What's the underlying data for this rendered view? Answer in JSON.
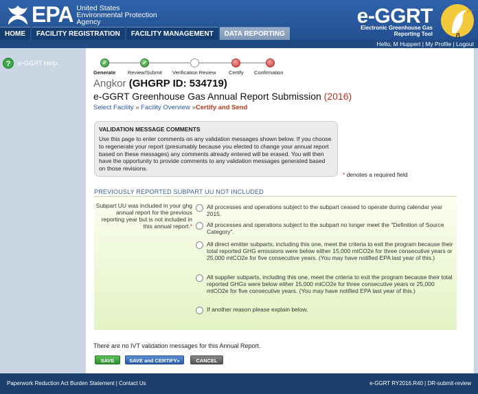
{
  "header": {
    "epa_word": "EPA",
    "agency_lines": [
      "United States",
      "Environmental Protection",
      "Agency"
    ],
    "app_title": "e-GGRT",
    "app_subtitle_lines": [
      "Electronic Greenhouse Gas",
      "Reporting Tool"
    ]
  },
  "nav": {
    "tabs": [
      {
        "label": "HOME",
        "active": false
      },
      {
        "label": "FACILITY REGISTRATION",
        "active": false
      },
      {
        "label": "FACILITY MANAGEMENT",
        "active": false
      },
      {
        "label": "DATA REPORTING",
        "active": true
      }
    ]
  },
  "userbar": {
    "greeting": "Hello, M Huppert",
    "sep1": " | ",
    "my_profile": "My Profile",
    "sep2": " | ",
    "logout": "Logout"
  },
  "sidebar": {
    "help_icon_glyph": "?",
    "help_label": "e-GGRT Help"
  },
  "steps": [
    {
      "label": "Generate",
      "state": "done",
      "active": true
    },
    {
      "label": "Review/Submit",
      "state": "done",
      "active": false
    },
    {
      "label": "Verification Review",
      "state": "todo",
      "active": false
    },
    {
      "label": "Certify",
      "state": "fail",
      "active": false
    },
    {
      "label": "Confirmation",
      "state": "fail",
      "active": false
    }
  ],
  "facility": {
    "name": "Angkor",
    "id_text": "(GHGRP ID: 534719)"
  },
  "page_title": {
    "text": "e-GGRT Greenhouse Gas Annual Report Submission",
    "year": "(2016)"
  },
  "breadcrumb": {
    "item1": "Select Facility",
    "sep1": " » ",
    "item2": "Facility Overview",
    "sep2": " »",
    "current": "Certify and Send"
  },
  "validation": {
    "heading": "VALIDATION MESSAGE COMMENTS",
    "body": "Use this page to enter comments on any validation messages shown below. If you choose to regenerate your report (presumably because you elected to change your annual report based on these messages) any comments already entered will be erased. You will then have the opportunity to provide comments to any validation messages generated based on those revisions."
  },
  "required_note": {
    "star": "*",
    "text": "denotes a required field"
  },
  "subpart": {
    "heading": "PREVIOUSLY REPORTED SUBPART UU NOT INCLUDED",
    "question": "Subpart UU was included in your ghg annual report for the previous reporting year but is not included in this annual report.",
    "star": "*",
    "options": [
      "All processes and operations subject to the subpart ceased to operate during calendar year 2015.",
      "All processes and operations subject to the subpart no longer meet the \"Definition of Source Category\".",
      "All direct emitter subparts, including this one, meet the criteria to exit the program because their total reported GHG emissions were below either 15,000 mtCO2e for three consecutive years or 25,000 mtCO2e for five consecutive years. (You may have notified EPA last year of this.)",
      "All supplier subparts, including this one, meet the criteria to exit the program because their total reported GHGs were below either 15,000 mtCO2e for three consecutive years or 25,000 mtCO2e for five consecutive years. (You may have notified EPA last year of this.)",
      "If another reason please explain below."
    ]
  },
  "ivt_message": "There are no IVT validation messages for this Annual Report.",
  "buttons": {
    "save": "SAVE",
    "save_certify": "SAVE and CERTIFY»",
    "cancel": "CANCEL"
  },
  "footer": {
    "paperwork": "Paperwork Reduction Act Burden Statement",
    "sep": " | ",
    "contact": "Contact Us",
    "version": "e-GGRT RY2016.R40",
    "sep2": " | ",
    "env": "DR-submit-review"
  },
  "colors": {
    "header_blue": "#2b5aa0",
    "sidebar": "#cad6e3",
    "accent_red": "#c0391b",
    "link_blue": "#2a56a8",
    "section_green": "#e4f3c4"
  }
}
